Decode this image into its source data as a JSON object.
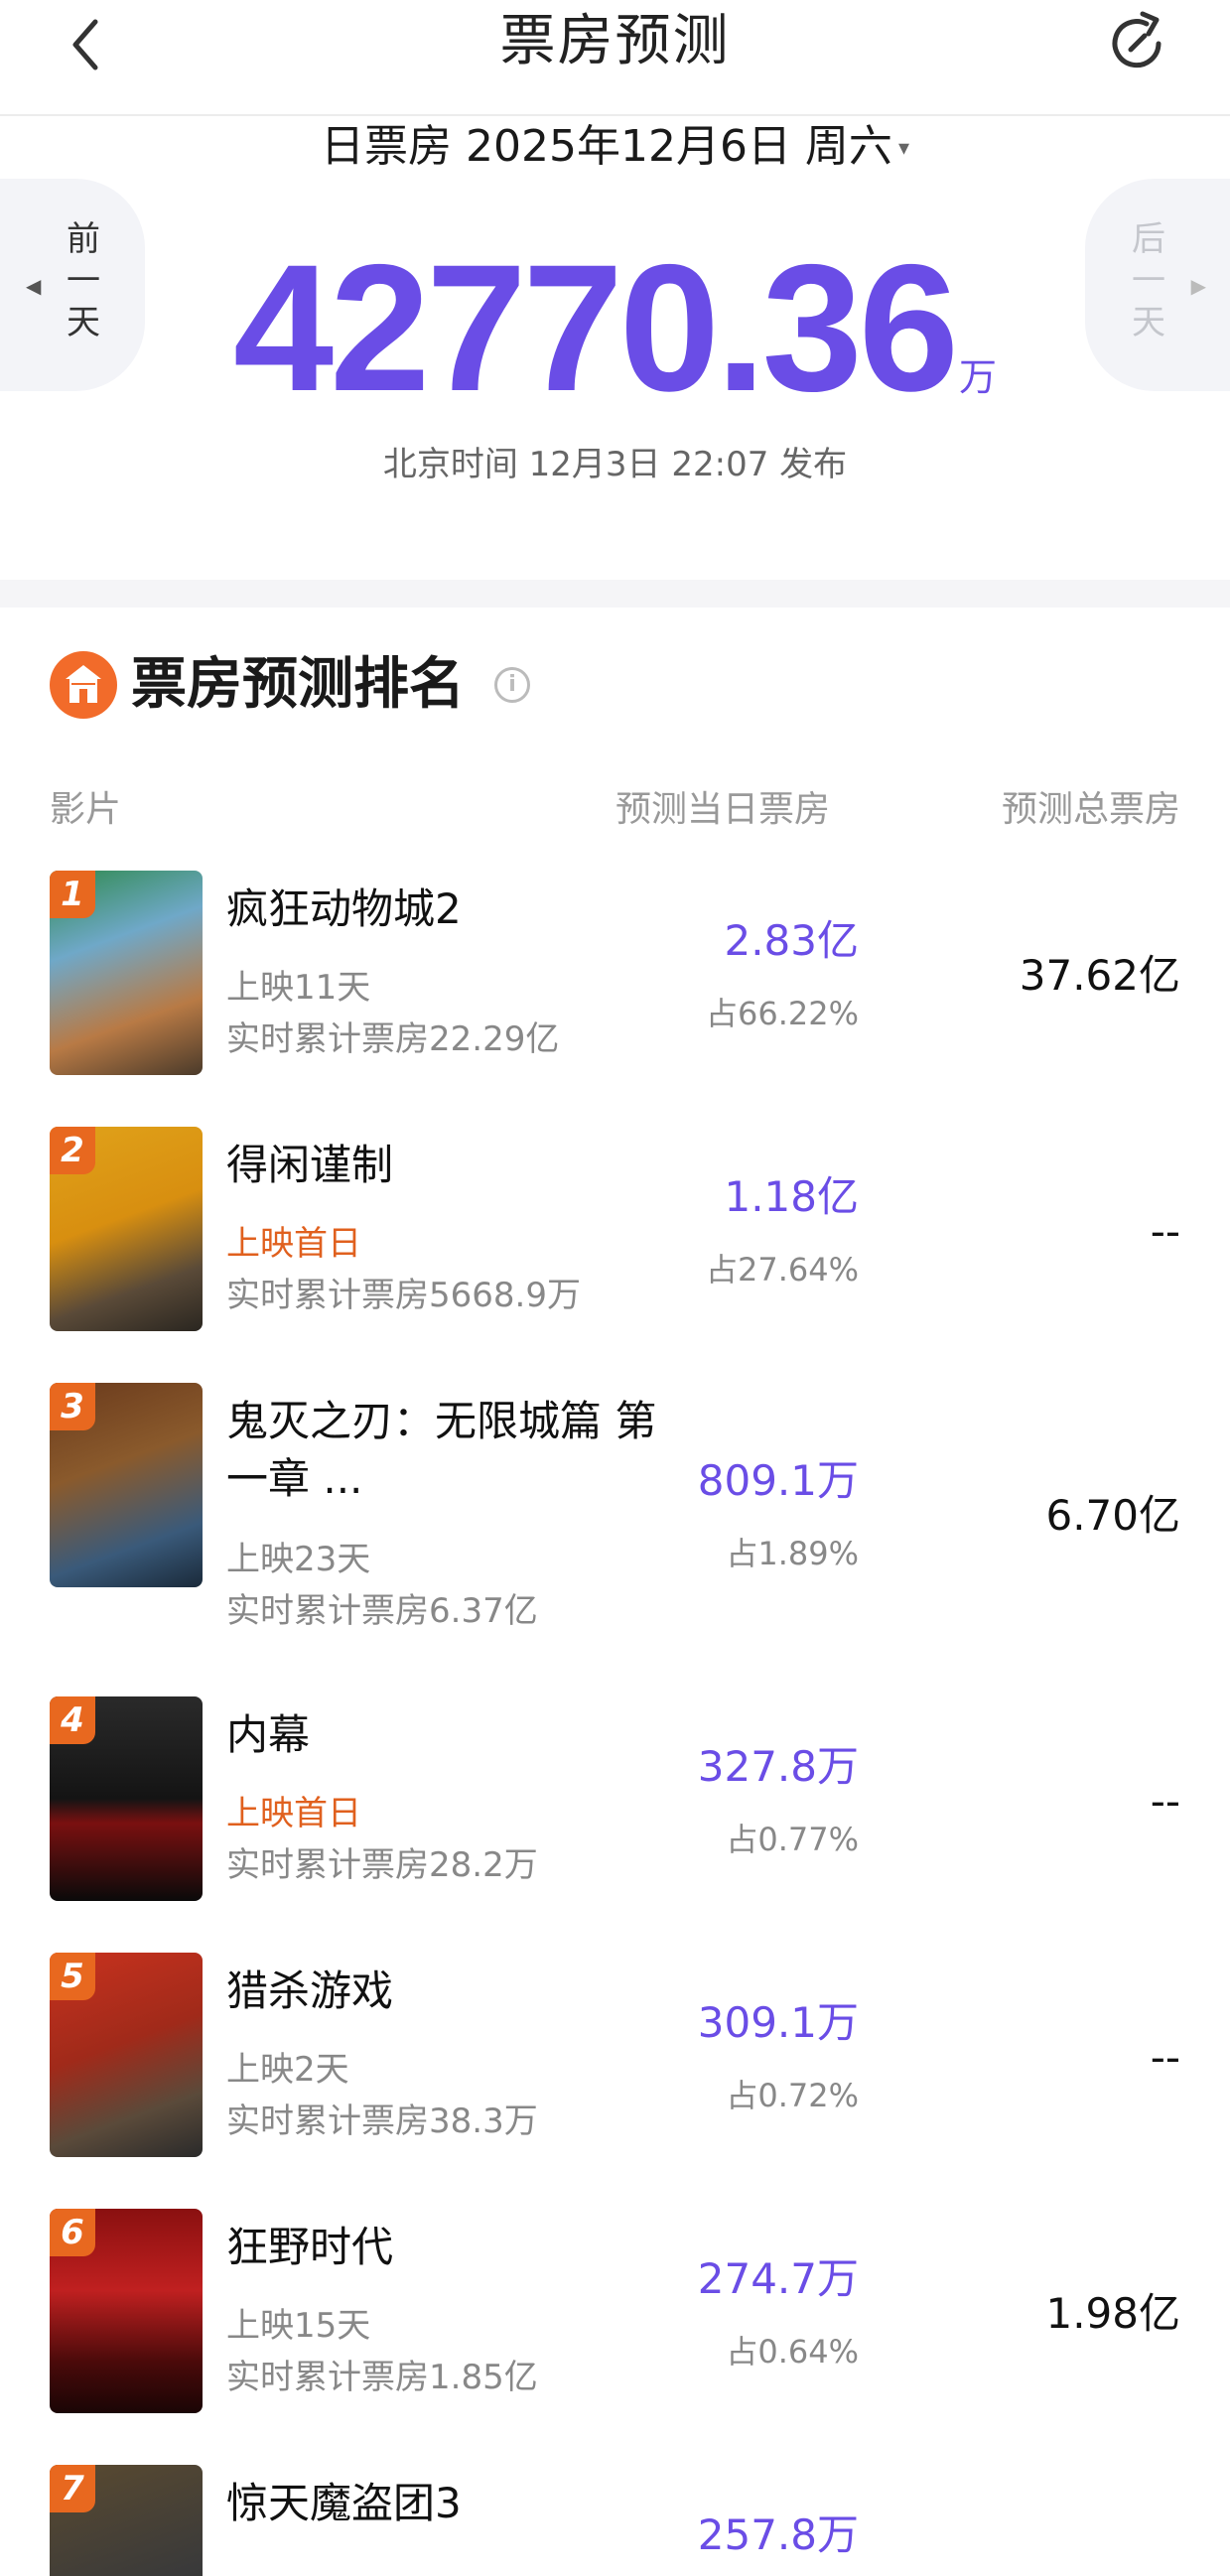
{
  "header": {
    "title": "票房预测"
  },
  "date_selector": {
    "label": "日票房 2025年12月6日 周六",
    "caret": "▾"
  },
  "nav": {
    "prev_label": "前一天",
    "next_label": "后一天"
  },
  "total": {
    "value": "42770.36",
    "unit": "万"
  },
  "publish_time": "北京时间 12月3日 22:07 发布",
  "section": {
    "title": "票房预测排名",
    "info": "i"
  },
  "columns": {
    "film": "影片",
    "day": "预测当日票房",
    "total": "预测总票房"
  },
  "colors": {
    "accent": "#6a4de6",
    "rank_badge": "#e8681f",
    "first_day": "#e0601e"
  },
  "films": [
    {
      "rank": "1",
      "name": "疯狂动物城2",
      "status": "上映11天",
      "first_day": false,
      "cumulative": "实时累计票房22.29亿",
      "day_box": "2.83亿",
      "share": "占66.22%",
      "total_box": "37.62亿",
      "poster_bg": "linear-gradient(160deg,#2f8a4e 0%,#6fa8c8 35%,#b87a45 70%,#4a3a2a 100%)"
    },
    {
      "rank": "2",
      "name": "得闲谨制",
      "status": "上映首日",
      "first_day": true,
      "cumulative": "实时累计票房5668.9万",
      "day_box": "1.18亿",
      "share": "占27.64%",
      "total_box": "--",
      "poster_bg": "linear-gradient(160deg,#e0a21a 0%,#d88f10 45%,#5a4a38 75%,#2a2620 100%)"
    },
    {
      "rank": "3",
      "name": "鬼灭之刃：无限城篇 第一章 ...",
      "status": "上映23天",
      "first_day": false,
      "cumulative": "实时累计票房6.37亿",
      "day_box": "809.1万",
      "share": "占1.89%",
      "total_box": "6.70亿",
      "poster_bg": "linear-gradient(160deg,#6a3a1c 0%,#8a5a2c 40%,#3a5a7a 75%,#1a2a3a 100%)"
    },
    {
      "rank": "4",
      "name": "内幕",
      "status": "上映首日",
      "first_day": true,
      "cumulative": "实时累计票房28.2万",
      "day_box": "327.8万",
      "share": "占0.77%",
      "total_box": "--",
      "poster_bg": "linear-gradient(180deg,#2a2a2a 0%,#141414 50%,#7a1010 62%,#0a0a0a 100%)"
    },
    {
      "rank": "5",
      "name": "猎杀游戏",
      "status": "上映2天",
      "first_day": false,
      "cumulative": "实时累计票房38.3万",
      "day_box": "309.1万",
      "share": "占0.72%",
      "total_box": "--",
      "poster_bg": "linear-gradient(160deg,#c8321e 0%,#a02a1a 45%,#5a4a3a 75%,#2a2a2a 100%)"
    },
    {
      "rank": "6",
      "name": "狂野时代",
      "status": "上映15天",
      "first_day": false,
      "cumulative": "实时累计票房1.85亿",
      "day_box": "274.7万",
      "share": "占0.64%",
      "total_box": "1.98亿",
      "poster_bg": "linear-gradient(180deg,#8a1010 0%,#c02020 40%,#4a0a0a 75%,#1a0505 100%)"
    },
    {
      "rank": "7",
      "name": "惊天魔盗团3",
      "status": "",
      "first_day": false,
      "cumulative": "",
      "day_box": "257.8万",
      "share": "",
      "total_box": "",
      "poster_bg": "linear-gradient(160deg,#5a4a30 0%,#3a3a3a 60%,#222 100%)"
    }
  ]
}
